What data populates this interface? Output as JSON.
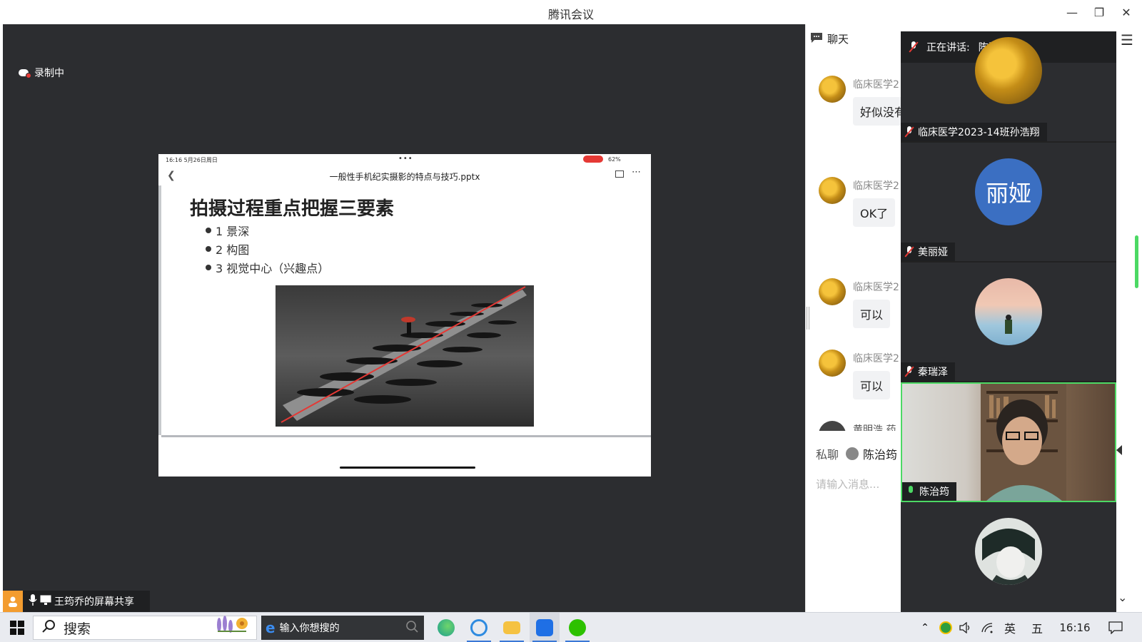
{
  "window": {
    "title": "腾讯会议"
  },
  "recording": {
    "label": "录制中"
  },
  "shared_slide": {
    "status_time": "16:16  5月26日周日",
    "status_dots": "•••",
    "battery": "62%",
    "file_name": "一般性手机纪实摄影的特点与技巧.pptx",
    "title": "拍摄过程重点把握三要素",
    "points": [
      "1  景深",
      "2  构图",
      "3  视觉中心（兴趣点）"
    ]
  },
  "sharer": {
    "label": "王筠乔的屏幕共享"
  },
  "chat": {
    "header": "聊天",
    "messages": [
      {
        "name": "临床医学2",
        "text": "好似没有"
      },
      {
        "name": "临床医学2",
        "text": "OK了"
      },
      {
        "name": "临床医学2",
        "text": "可以"
      },
      {
        "name": "临床医学2",
        "text": "可以"
      }
    ],
    "partial_name": "黄明浩 药",
    "private_label": "私聊",
    "private_target": "陈治筠",
    "input_placeholder": "请输入消息..."
  },
  "videos": {
    "speaking_label": "正在讲话:",
    "speaking_name": "陈治筠;",
    "participants": [
      {
        "name": "临床医学2023-14班孙浩翔",
        "avatar": "sunflower",
        "mic": "off"
      },
      {
        "name": "美丽娅",
        "avatar_text": "丽娅",
        "mic": "off"
      },
      {
        "name": "秦瑞泽",
        "avatar": "sky",
        "mic": "off"
      },
      {
        "name": "陈治筠",
        "avatar": "camera",
        "mic": "on"
      },
      {
        "name": "",
        "avatar": "anime",
        "mic": "off"
      }
    ]
  },
  "taskbar": {
    "search_label": "搜索",
    "browser_placeholder": "输入你想搜的",
    "ime_lang": "英",
    "ime_mode": "五",
    "clock": "16:16"
  },
  "colors": {
    "stage_bg": "#2c2d30",
    "accent_green": "#4cd964",
    "record_red": "#e53935",
    "avatar_blue": "#3b6fc2"
  }
}
